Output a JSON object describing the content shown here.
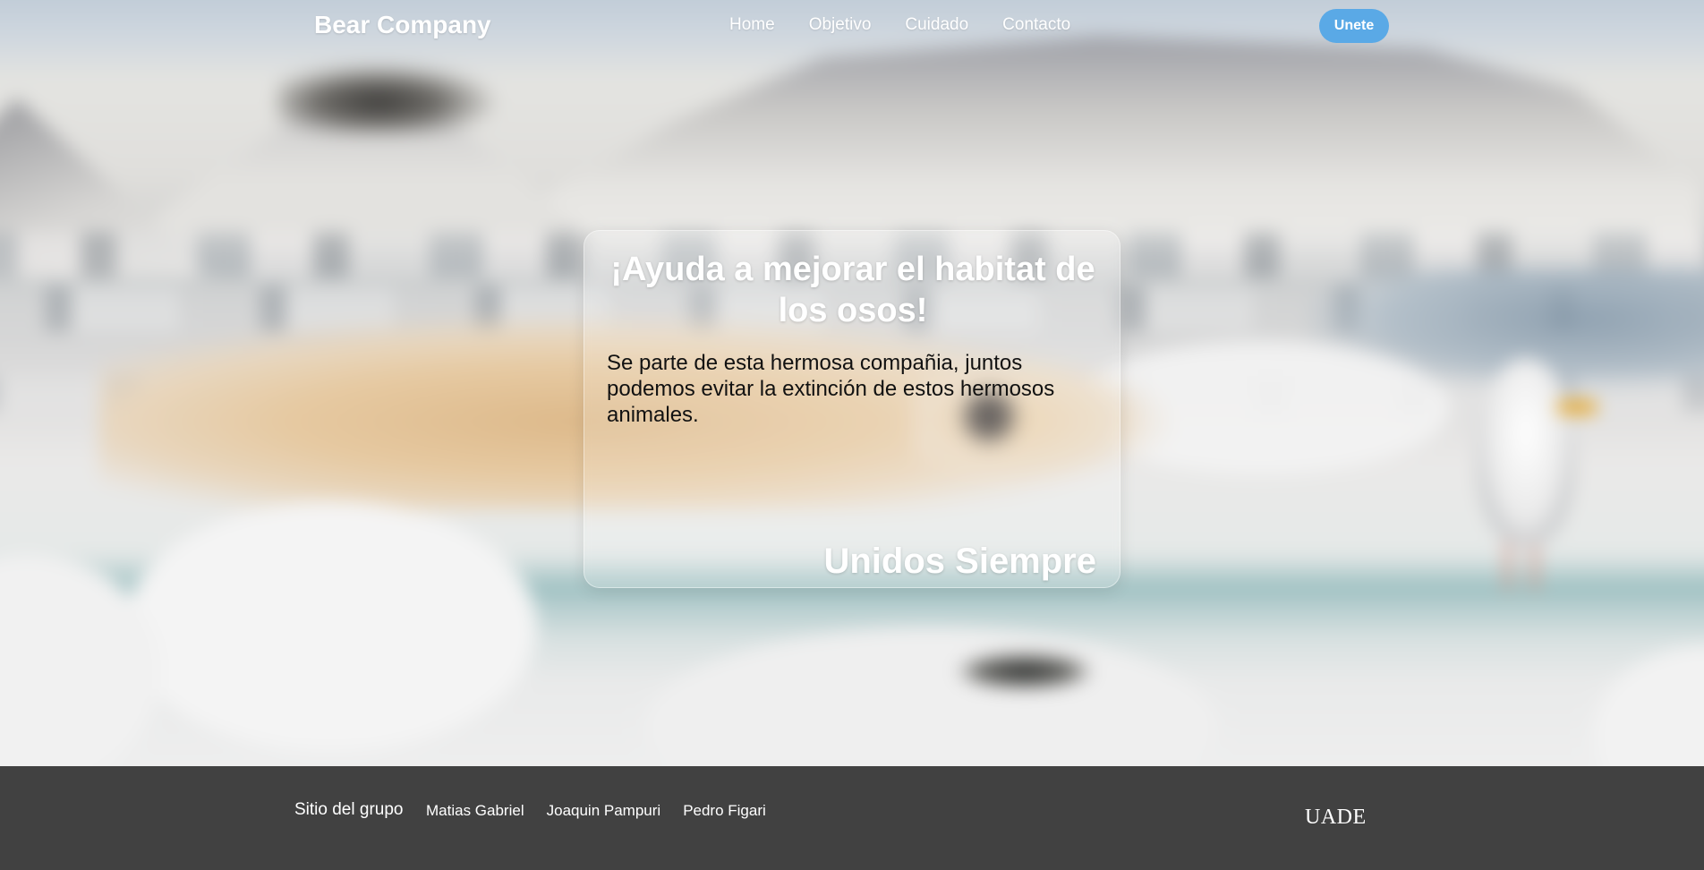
{
  "navbar": {
    "brand": "Bear Company",
    "links": [
      {
        "label": "Home"
      },
      {
        "label": "Objetivo"
      },
      {
        "label": "Cuidado"
      },
      {
        "label": "Contacto"
      }
    ],
    "join_button": "Unete"
  },
  "hero": {
    "title": "¡Ayuda a mejorar el habitat de los osos!",
    "text": "Se parte de esta hermosa compañia, juntos podemos evitar la extinción de estos hermosos animales.",
    "tagline": "Unidos Siempre"
  },
  "footer": {
    "title": "Sitio del grupo",
    "members": [
      {
        "label": "Matias Gabriel"
      },
      {
        "label": "Joaquin Pampuri"
      },
      {
        "label": "Pedro Figari"
      }
    ],
    "logo_text": "UADE"
  },
  "colors": {
    "accent": "#5aa9e6",
    "footer_bg": "#414141",
    "text_white": "#ffffff"
  }
}
